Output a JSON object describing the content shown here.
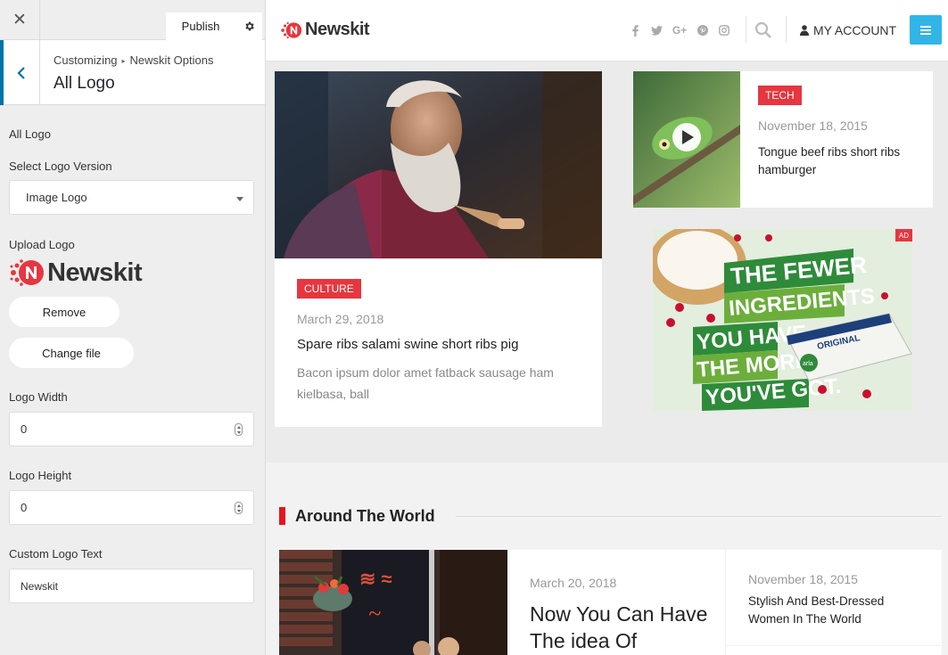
{
  "customizer": {
    "close_icon": "close-icon",
    "publish_label": "Publish",
    "breadcrumb": {
      "root": "Customizing",
      "section": "Newskit Options"
    },
    "section_title": "All Logo",
    "group_label": "All Logo",
    "select_logo_version": {
      "label": "Select Logo Version",
      "value": "Image Logo"
    },
    "upload_logo": {
      "label": "Upload Logo",
      "logo_text": "Newskit",
      "remove_label": "Remove",
      "change_label": "Change file"
    },
    "logo_width": {
      "label": "Logo Width",
      "value": "0"
    },
    "logo_height": {
      "label": "Logo Height",
      "value": "0"
    },
    "custom_logo_text": {
      "label": "Custom Logo Text",
      "placeholder": "Newskit"
    },
    "accent_color": "#0073aa"
  },
  "site": {
    "logo_text": "Newskit",
    "social_icons": [
      "facebook-icon",
      "twitter-icon",
      "google-plus-icon",
      "pinterest-icon",
      "instagram-icon"
    ],
    "account_label": "MY ACCOUNT",
    "menu_button_color": "#31b5e6",
    "brand_color": "#e6363f",
    "posts": {
      "featured": {
        "tag": "CULTURE",
        "date": "March 29, 2018",
        "title": "Spare ribs salami swine short ribs pig",
        "excerpt": "Bacon ipsum dolor amet fatback sausage ham kielbasa, ball"
      },
      "side": {
        "tag": "TECH",
        "date": "November 18, 2015",
        "title": "Tongue beef ribs short ribs hamburger"
      }
    },
    "ad": {
      "badge": "AD",
      "lines": [
        "THE FEWER",
        "INGREDIENTS",
        "YOU HAVE",
        "THE MORE",
        "YOU'VE GOT."
      ],
      "product_brand": "arla",
      "product_label": "ORIGINAL"
    },
    "around_the_world": {
      "heading": "Around The World",
      "main_post": {
        "date": "March 20, 2018",
        "title": "Now You Can Have The idea Of"
      },
      "side_post": {
        "date": "November 18, 2015",
        "title": "Stylish And Best-Dressed Women In The World"
      }
    }
  }
}
